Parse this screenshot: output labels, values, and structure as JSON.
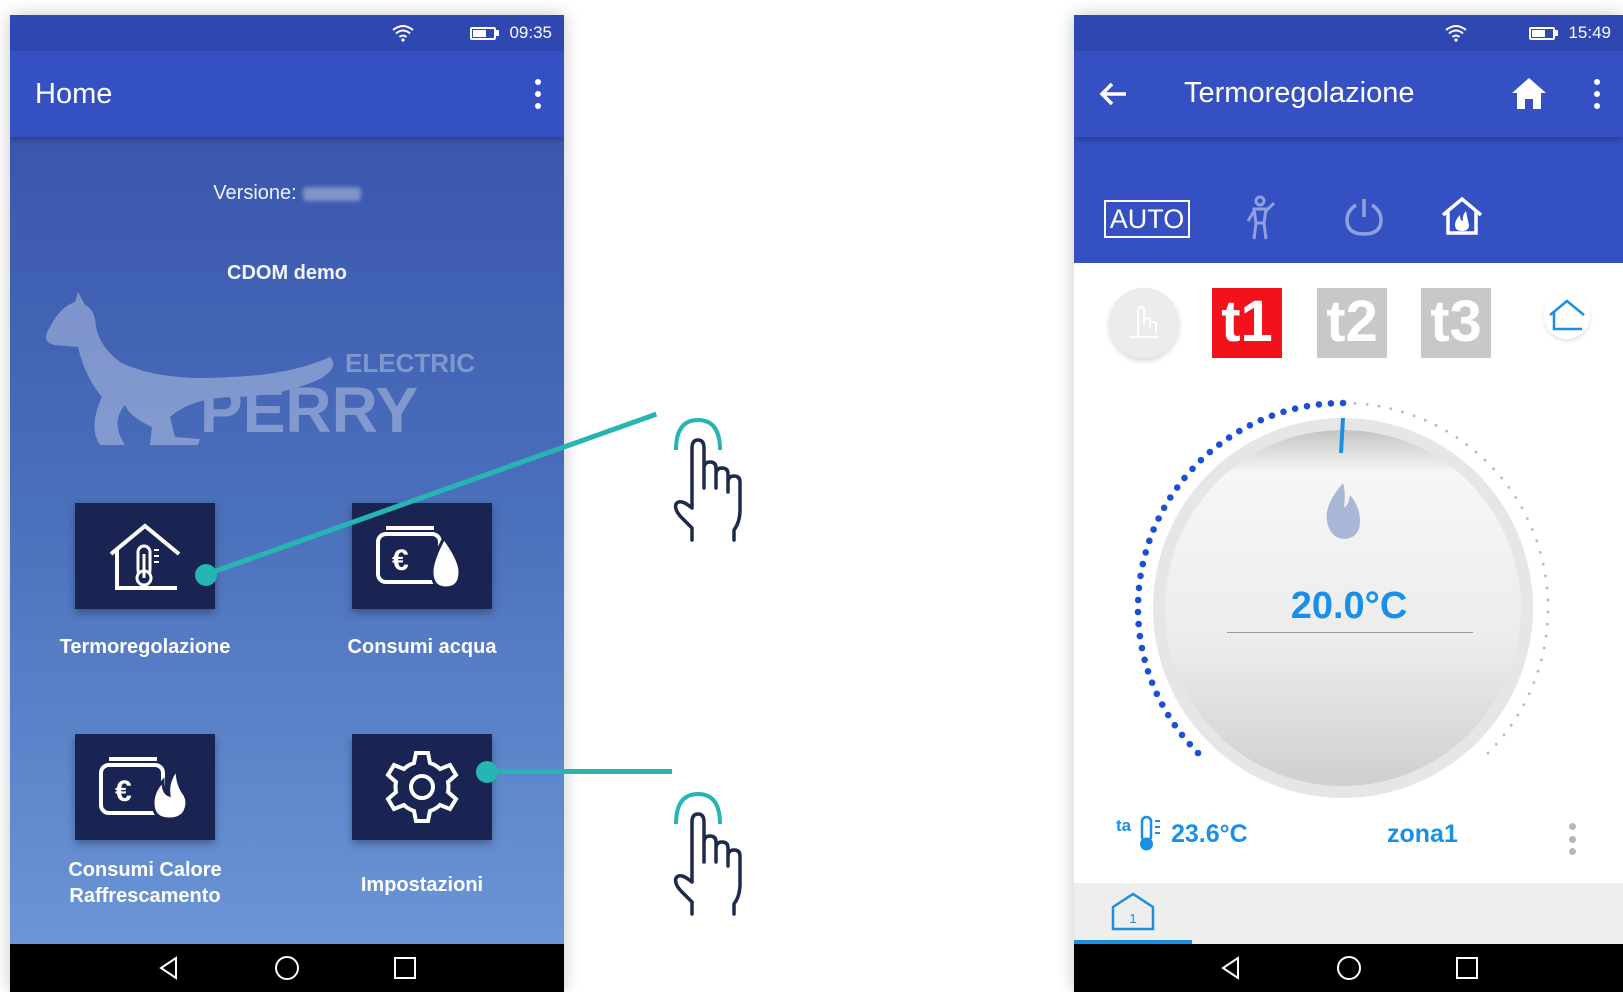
{
  "left_screen": {
    "status_time": "09:35",
    "title": "Home",
    "version_label": "Versione:",
    "company": "CDOM demo",
    "logo_text_1": "ELECTRIC",
    "logo_text_2": "PERRY",
    "tiles": [
      {
        "label": "Termoregolazione",
        "icon": "house-thermometer-icon"
      },
      {
        "label": "Consumi acqua",
        "icon": "wallet-water-icon"
      },
      {
        "label_line1": "Consumi Calore",
        "label_line2": "Raffrescamento",
        "icon": "wallet-flame-icon"
      },
      {
        "label": "Impostazioni",
        "icon": "gear-icon"
      }
    ]
  },
  "right_screen": {
    "status_time": "15:49",
    "title": "Termoregolazione",
    "mode_auto": "AUTO",
    "t_buttons": [
      "t1",
      "t2",
      "t3"
    ],
    "setpoint": "20.0°C",
    "ambient_prefix": "ta",
    "ambient_temp": "23.6°C",
    "zone": "zona1",
    "zone_tab": "1"
  },
  "colors": {
    "appbar": "#3550c2",
    "statusbar": "#2f47b0",
    "accent_teal": "#26b5b2",
    "t1_active": "#f1121c",
    "t_inactive": "#c8c8c8",
    "temp_blue": "#1890e8",
    "tile_bg": "#1a2452"
  }
}
